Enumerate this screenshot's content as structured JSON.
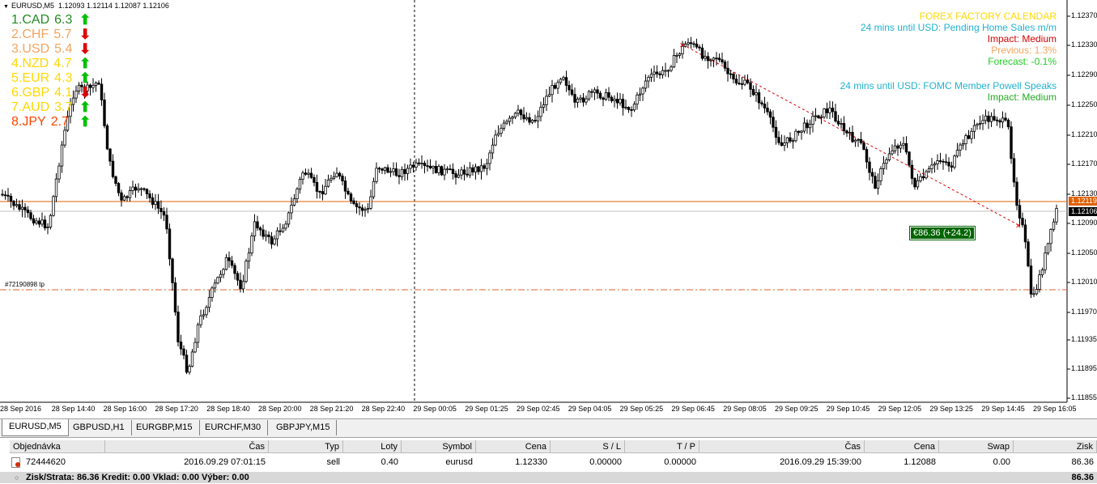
{
  "chart": {
    "title_symbol": "EURUSD,M5",
    "title_prices": "1.12093 1.12114 1.12087 1.12106",
    "price_labels": [
      "1.12370",
      "1.12330",
      "1.12290",
      "1.12250",
      "1.12210",
      "1.12170",
      "1.12130",
      "1.12090",
      "1.12050",
      "1.12010",
      "1.11970",
      "1.11935",
      "1.11895",
      "1.11855"
    ],
    "current_price_orange": "1.12119",
    "current_price_black": "1.12106",
    "time_labels": [
      "28 Sep 2016",
      "28 Sep 14:40",
      "28 Sep 16:00",
      "28 Sep 17:20",
      "28 Sep 18:40",
      "28 Sep 20:00",
      "28 Sep 21:20",
      "28 Sep 22:40",
      "29 Sep 00:05",
      "29 Sep 01:25",
      "29 Sep 02:45",
      "29 Sep 04:05",
      "29 Sep 05:25",
      "29 Sep 06:45",
      "29 Sep 08:05",
      "29 Sep 09:25",
      "29 Sep 10:45",
      "29 Sep 12:05",
      "29 Sep 13:25",
      "29 Sep 14:45",
      "29 Sep 16:05"
    ],
    "profit_tag": "€86.36 (+24.2)",
    "order_tag": "#72190898 tp",
    "colors": {
      "up": "#00c000",
      "down": "#dd0000",
      "candle": "#000000",
      "bid_line": "#e06000",
      "tp_line": "#e06030"
    }
  },
  "strength": [
    {
      "rank": "1.CAD",
      "value": "6.3",
      "color": "#228b22",
      "arrow": "up"
    },
    {
      "rank": "2.CHF",
      "value": "5.7",
      "color": "#f4a460",
      "arrow": "down"
    },
    {
      "rank": "3.USD",
      "value": "5.4",
      "color": "#f4a460",
      "arrow": "down"
    },
    {
      "rank": "4.NZD",
      "value": "4.7",
      "color": "#ffd700",
      "arrow": "up"
    },
    {
      "rank": "5.EUR",
      "value": "4.3",
      "color": "#ffd700",
      "arrow": "up"
    },
    {
      "rank": "6.GBP",
      "value": "4.1",
      "color": "#ffd700",
      "arrow": "down"
    },
    {
      "rank": "7.AUD",
      "value": "3.7",
      "color": "#ffd700",
      "arrow": "up"
    },
    {
      "rank": "8.JPY",
      "value": "2.7",
      "color": "#ff4500",
      "arrow": "up"
    }
  ],
  "forex_factory": {
    "heading": "FOREX FACTORY CALENDAR",
    "event1": "24 mins until USD: Pending Home Sales m/m",
    "impact1": "Impact: Medium",
    "previous1": "Previous: 1.3%",
    "forecast1": "Forecast: -0.1%",
    "event2": "24 mins until USD: FOMC Member Powell Speaks",
    "impact2": "Impact: Medium"
  },
  "tabs": [
    "EURUSD,M5",
    "GBPUSD,H1",
    "EURGBP,M15",
    "EURCHF,M30",
    "GBPJPY,M15"
  ],
  "terminal": {
    "headers": [
      "Objednávka",
      "Čas",
      "Typ",
      "Loty",
      "Symbol",
      "Cena",
      "S / L",
      "T / P",
      "Čas",
      "Cena",
      "Swap",
      "Zisk"
    ],
    "row": [
      "72444620",
      "2016.09.29 07:01:15",
      "sell",
      "0.40",
      "eurusd",
      "1.12330",
      "0.00000",
      "0.00000",
      "2016.09.29 15:39:00",
      "1.12088",
      "0.00",
      "86.36"
    ],
    "status": "Zisk/Strata: 86.36  Kredit: 0.00  Vklad: 0.00  Výber: 0.00",
    "status_total": "86.36"
  }
}
